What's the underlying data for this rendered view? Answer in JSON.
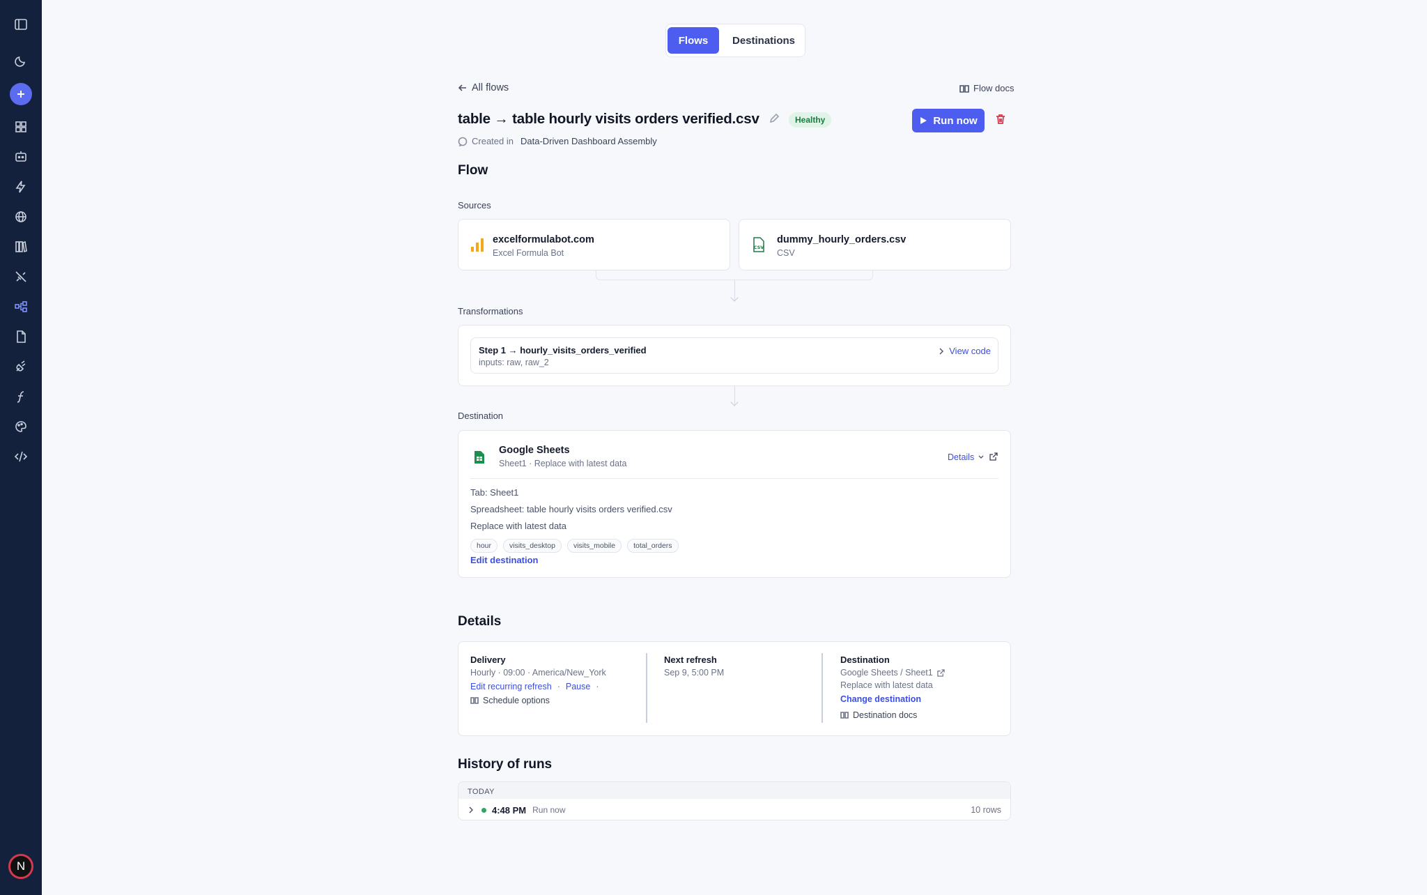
{
  "tabs": {
    "flows": "Flows",
    "destinations": "Destinations"
  },
  "nav": {
    "back": "All flows",
    "docs": "Flow docs"
  },
  "header": {
    "title": "table → table hourly visits orders verified.csv",
    "status": "Healthy",
    "run_label": "Run now",
    "created_prefix": "Created in",
    "created_project": "Data-Driven Dashboard Assembly"
  },
  "flow": {
    "heading": "Flow",
    "sources_label": "Sources",
    "sources": [
      {
        "name": "excelformulabot.com",
        "type": "Excel Formula Bot",
        "icon": "bar-chart-icon"
      },
      {
        "name": "dummy_hourly_orders.csv",
        "type": "CSV",
        "icon": "csv-file-icon"
      }
    ],
    "transformations_label": "Transformations",
    "step": {
      "title": "Step 1 → hourly_visits_orders_verified",
      "inputs": "inputs: raw, raw_2",
      "view_code": "View code"
    },
    "destination_label": "Destination",
    "destination": {
      "name": "Google Sheets",
      "subtitle": "Sheet1 · Replace with latest data",
      "details_label": "Details",
      "tab": "Tab: Sheet1",
      "spreadsheet": "Spreadsheet: table hourly visits orders verified.csv",
      "mode": "Replace with latest data",
      "columns": [
        "hour",
        "visits_desktop",
        "visits_mobile",
        "total_orders"
      ],
      "edit_label": "Edit destination"
    }
  },
  "details": {
    "heading": "Details",
    "delivery": {
      "title": "Delivery",
      "value": "Hourly · 09:00 · America/New_York",
      "edit": "Edit recurring refresh",
      "sep": "·",
      "pause": "Pause",
      "sep2": "·",
      "docs": "Schedule options"
    },
    "next_refresh": {
      "title": "Next refresh",
      "value": "Sep 9, 5:00 PM"
    },
    "destination": {
      "title": "Destination",
      "value": "Google Sheets / Sheet1",
      "mode": "Replace with latest data",
      "change": "Change destination",
      "docs": "Destination docs"
    }
  },
  "history": {
    "heading": "History of runs",
    "group": "TODAY",
    "runs": [
      {
        "time": "4:48 PM",
        "trigger": "Run now",
        "rows": "10 rows",
        "status_color": "#2fa760"
      }
    ]
  },
  "user": {
    "avatar_initial": "N"
  },
  "colors": {
    "accent": "#4d5df0",
    "sidebar": "#14213d",
    "healthy": "#1f7a44",
    "danger": "#d33a4e"
  }
}
